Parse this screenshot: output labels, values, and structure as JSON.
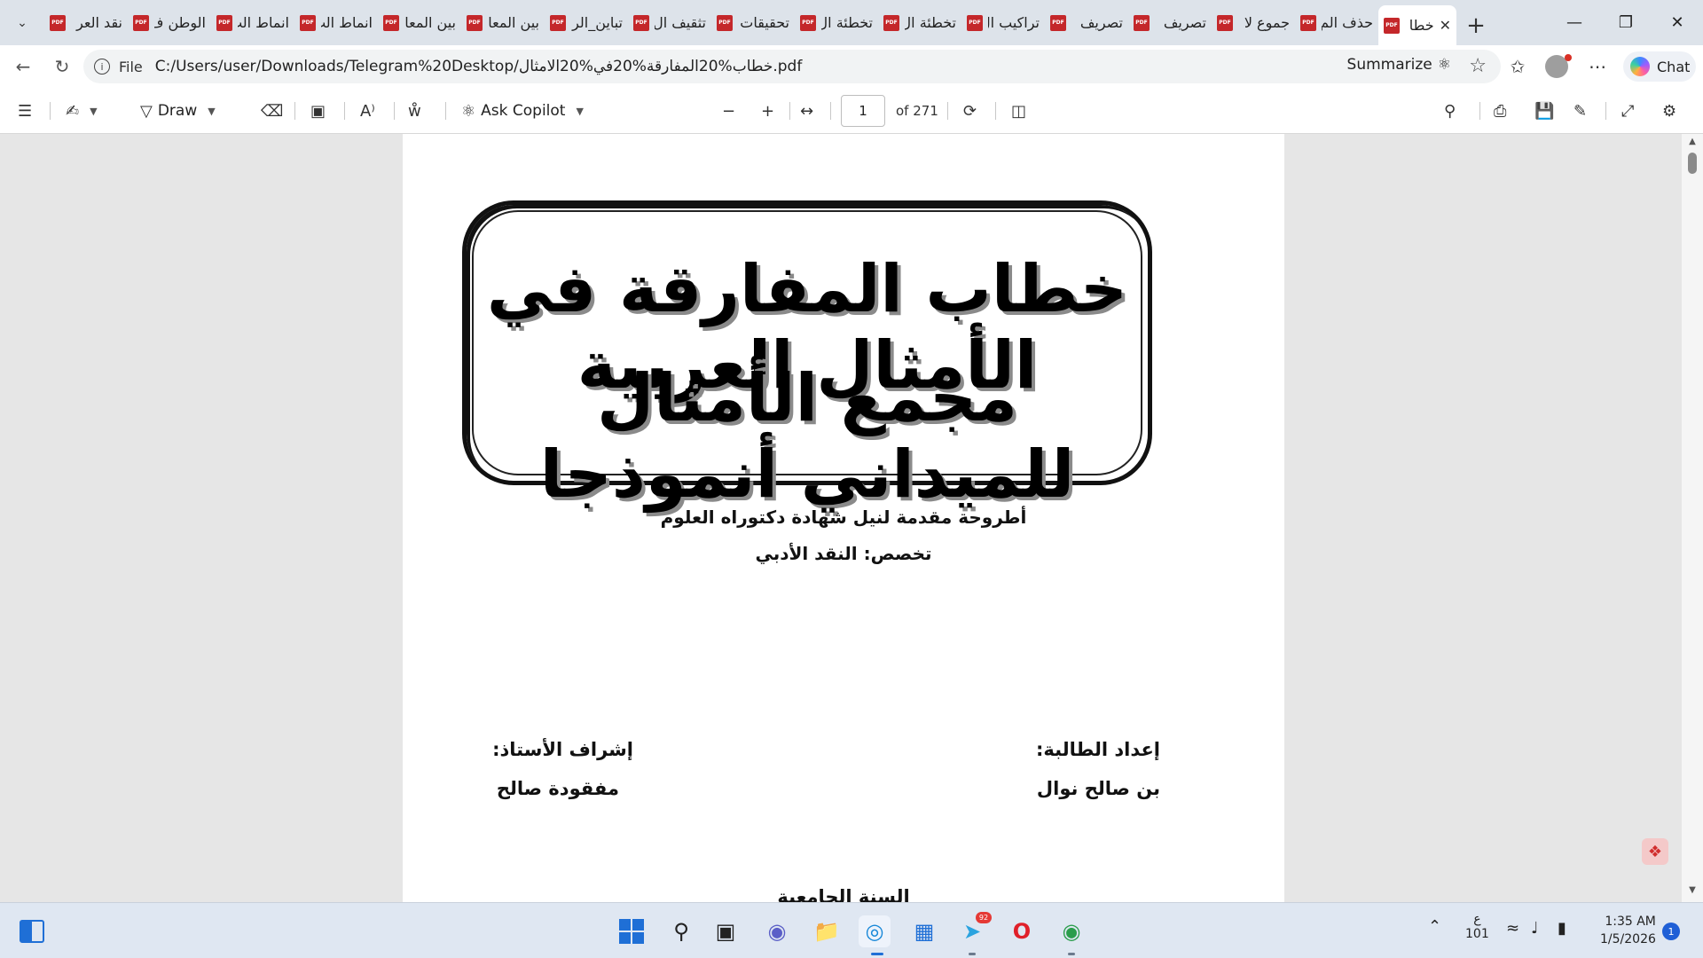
{
  "browser": {
    "tabs": [
      {
        "label": "نقد العر",
        "active": false
      },
      {
        "label": "الوطن ف",
        "active": false
      },
      {
        "label": "انماط الت",
        "active": false
      },
      {
        "label": "انماط الت",
        "active": false
      },
      {
        "label": "بين المعا",
        "active": false
      },
      {
        "label": "بين المعا",
        "active": false
      },
      {
        "label": "تباين_الر",
        "active": false
      },
      {
        "label": "تثقيف ال",
        "active": false
      },
      {
        "label": "تحقيقات",
        "active": false
      },
      {
        "label": "تخطئة ال",
        "active": false
      },
      {
        "label": "تخطئة ال",
        "active": false
      },
      {
        "label": "تراكيب ال",
        "active": false
      },
      {
        "label": "تصريف",
        "active": false
      },
      {
        "label": "تصريف",
        "active": false
      },
      {
        "label": "جموع لا",
        "active": false
      },
      {
        "label": "حذف الم",
        "active": false
      },
      {
        "label": "خطا",
        "active": true
      }
    ],
    "new_tab_label": "+",
    "file_label": "File",
    "url": "C:/Users/user/Downloads/Telegram%20Desktop/خطاب%20المفارقة%20في%20الامثال.pdf",
    "summarize_label": "Summarize",
    "chat_label": "Chat"
  },
  "pdf_toolbar": {
    "draw_label": "Draw",
    "ask_copilot_label": "Ask Copilot",
    "current_page": "1",
    "page_count_label": "of 271"
  },
  "document": {
    "title_line_1": "خطاب المفارقة في الأمثال العربية",
    "title_line_2": "مجمع الأمثال للميداني أنموذجا",
    "subtitle_1": "أطروحة مقدمة لنيل شهادة دكتوراه العلوم",
    "subtitle_2": "تخصص: النقد الأدبي",
    "student_heading": "إعداد الطالبة:",
    "student_name": "بن صالح نوال",
    "supervisor_heading": "إشراف الأستاذ:",
    "supervisor_name": "مفقودة صالح",
    "footer_partial": "السنة الجامعية"
  },
  "taskbar": {
    "tray_lang": "ع",
    "tray_num": "101",
    "time": "1:35 AM",
    "date": "1/5/2026",
    "notification_count": "1",
    "telegram_badge": "92"
  },
  "colors": {
    "pdf_icon": "#c4272a",
    "tab_strip": "#dde3ea",
    "taskbar": "#dfe7f2",
    "accent_blue": "#1f6fd6"
  }
}
